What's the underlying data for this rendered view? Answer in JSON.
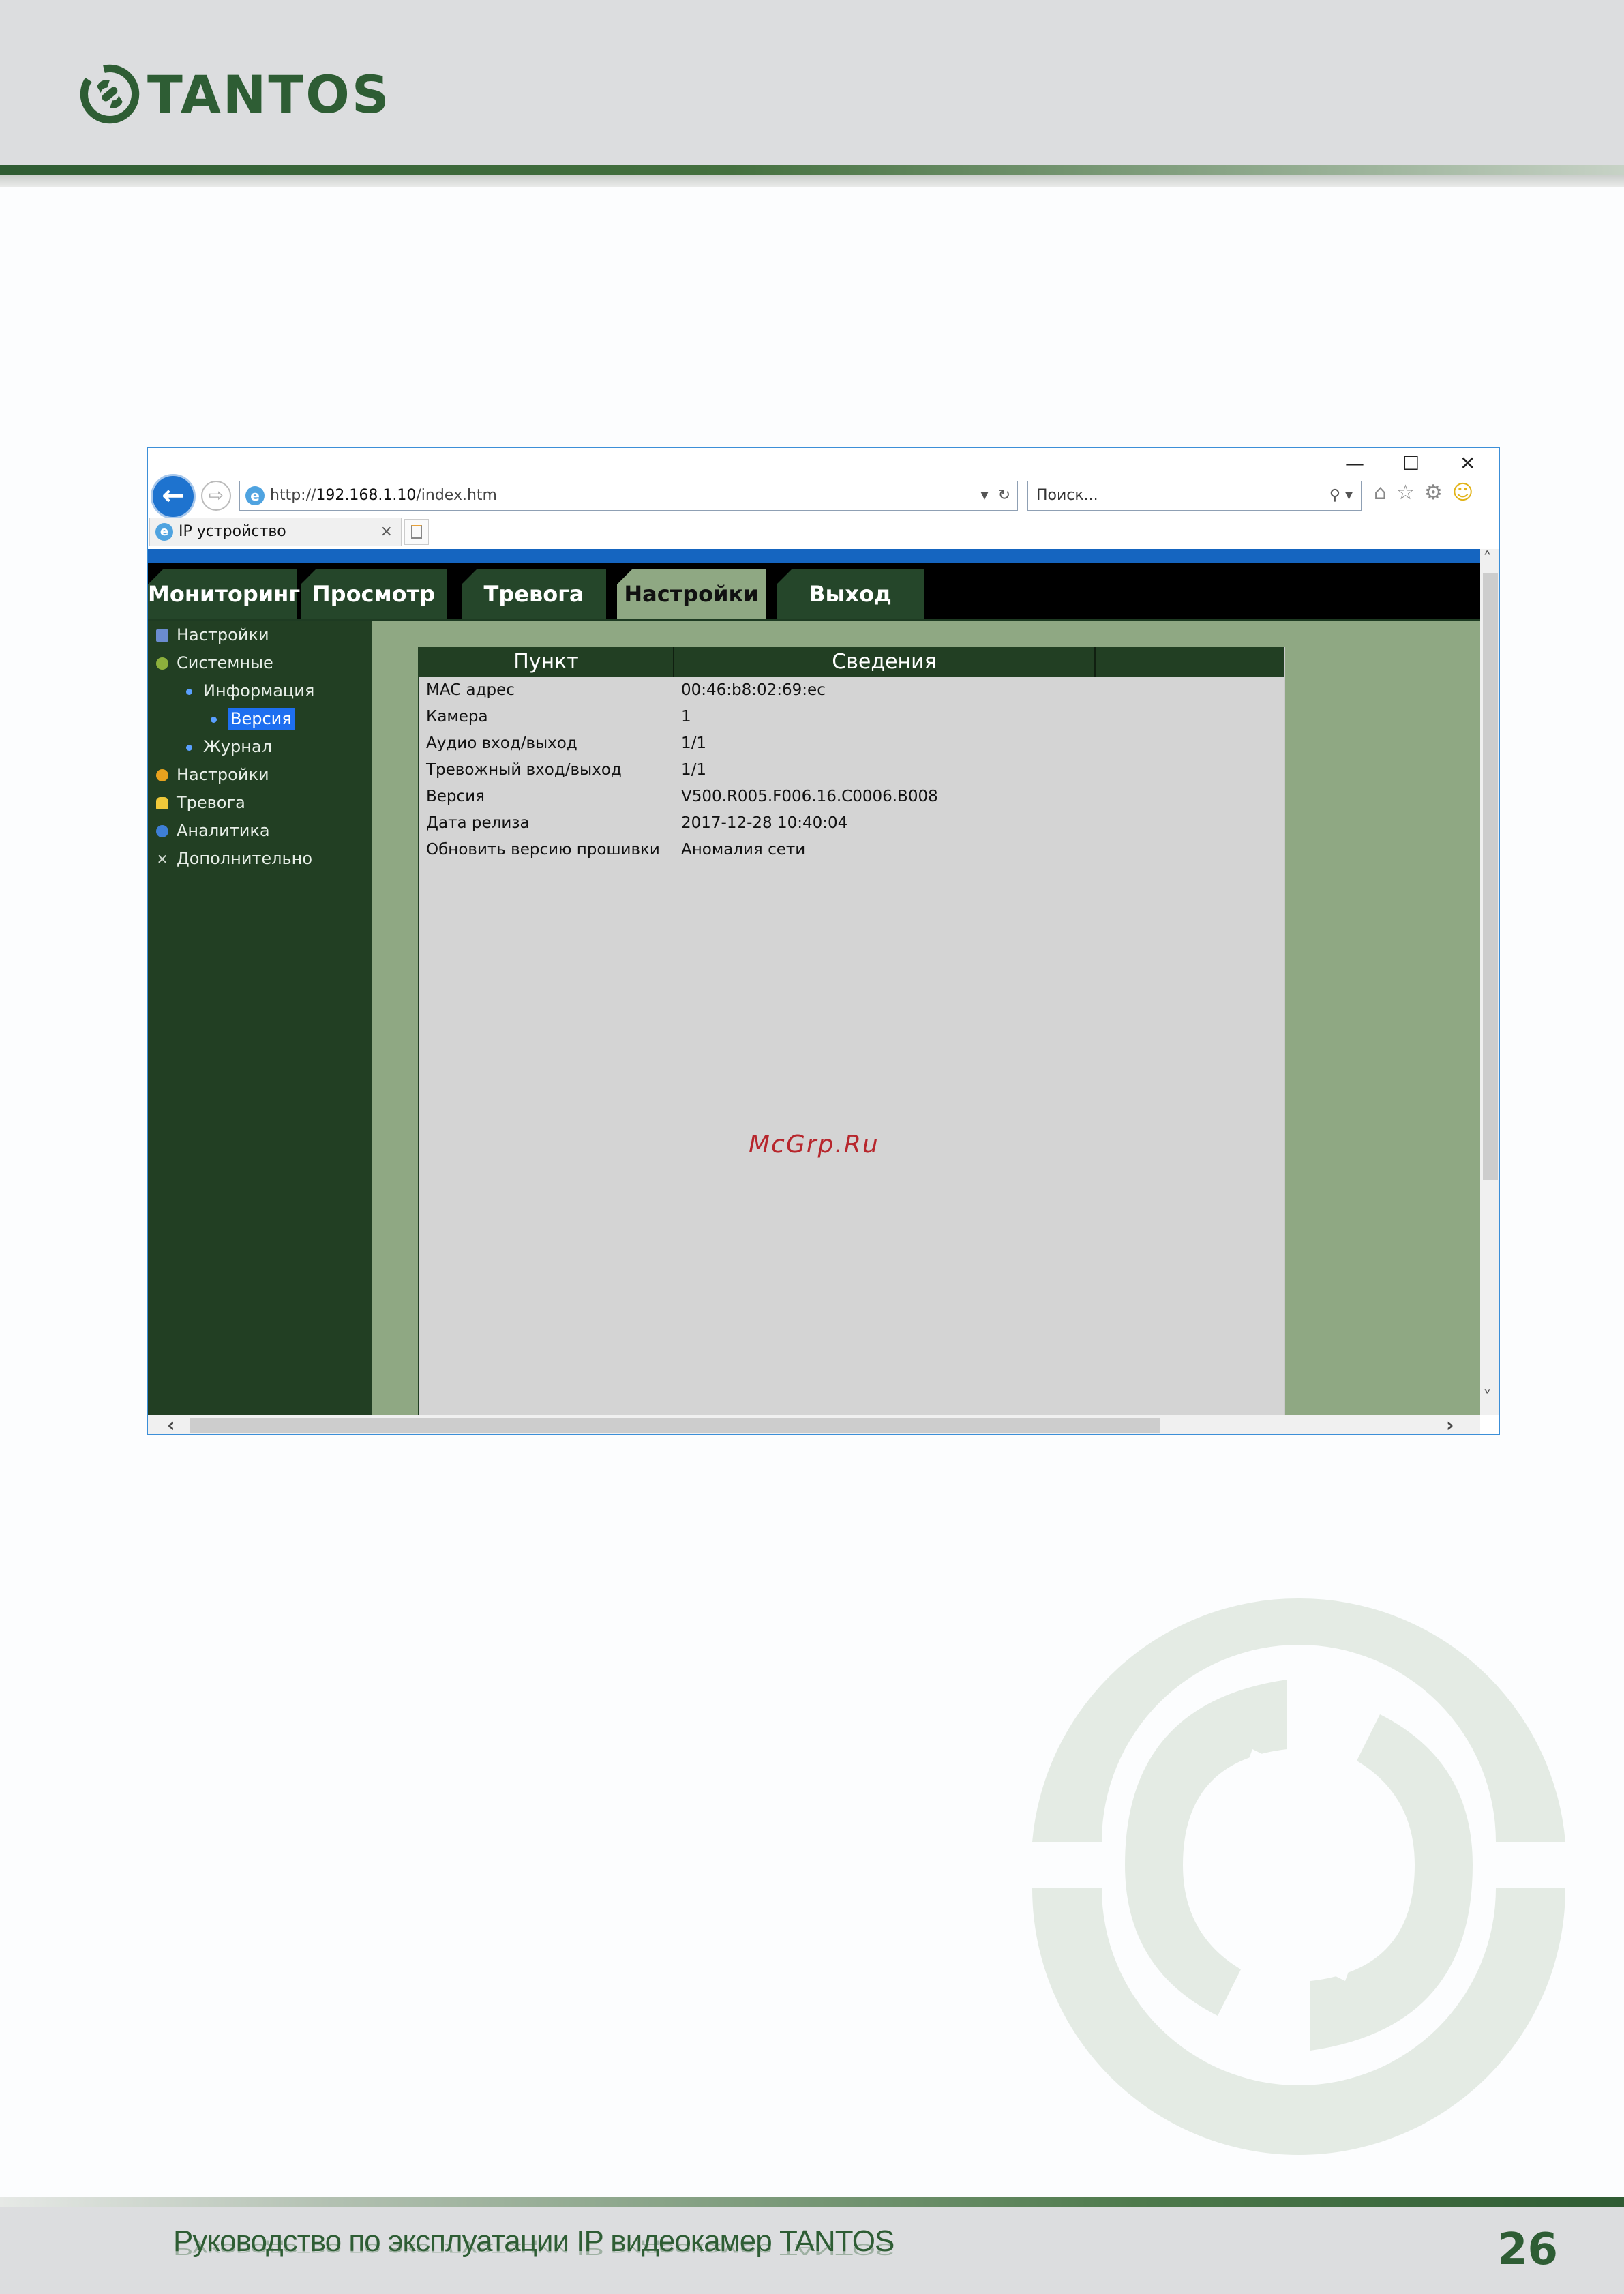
{
  "brand": {
    "name": "TANTOS",
    "color": "#2e5d34"
  },
  "browser": {
    "window_controls": [
      "—",
      "☐",
      "✕"
    ],
    "url_prefix": "http://",
    "url_host": "192.168.1.10",
    "url_path": "/index.htm",
    "search_placeholder": "Поиск...",
    "tab_title": "IP устройство"
  },
  "app": {
    "nav_tabs": [
      {
        "label": "Мониторинг"
      },
      {
        "label": "Просмотр"
      },
      {
        "label": "Тревога"
      },
      {
        "label": "Настройки",
        "active": true
      },
      {
        "label": "Выход"
      }
    ],
    "sidebar": [
      {
        "label": "Настройки",
        "icon": "settings-doc-icon"
      },
      {
        "label": "Системные",
        "icon": "system-icon"
      },
      {
        "label": "Информация",
        "icon": "bullet-icon"
      },
      {
        "label": "Версия",
        "icon": "bullet-icon",
        "selected": true
      },
      {
        "label": "Журнал",
        "icon": "bullet-icon"
      },
      {
        "label": "Настройки",
        "icon": "gear-icon"
      },
      {
        "label": "Тревога",
        "icon": "bell-icon"
      },
      {
        "label": "Аналитика",
        "icon": "analytics-icon"
      },
      {
        "label": "Дополнительно",
        "icon": "tools-icon"
      }
    ],
    "table": {
      "headers": [
        "Пункт",
        "Сведения"
      ],
      "rows": [
        [
          "MAC адрес",
          "00:46:b8:02:69:ec"
        ],
        [
          "Камера",
          "1"
        ],
        [
          "Аудио вход/выход",
          "1/1"
        ],
        [
          "Тревожный вход/выход",
          "1/1"
        ],
        [
          "Версия",
          "V500.R005.F006.16.C0006.B008"
        ],
        [
          "Дата релиза",
          "2017-12-28 10:40:04"
        ],
        [
          "Обновить версию прошивки",
          "Аномалия сети"
        ]
      ]
    }
  },
  "watermark": "McGrp.Ru",
  "footer": {
    "title": "Руководство по эксплуатации IP видеокамер TANTOS",
    "page": "26"
  }
}
